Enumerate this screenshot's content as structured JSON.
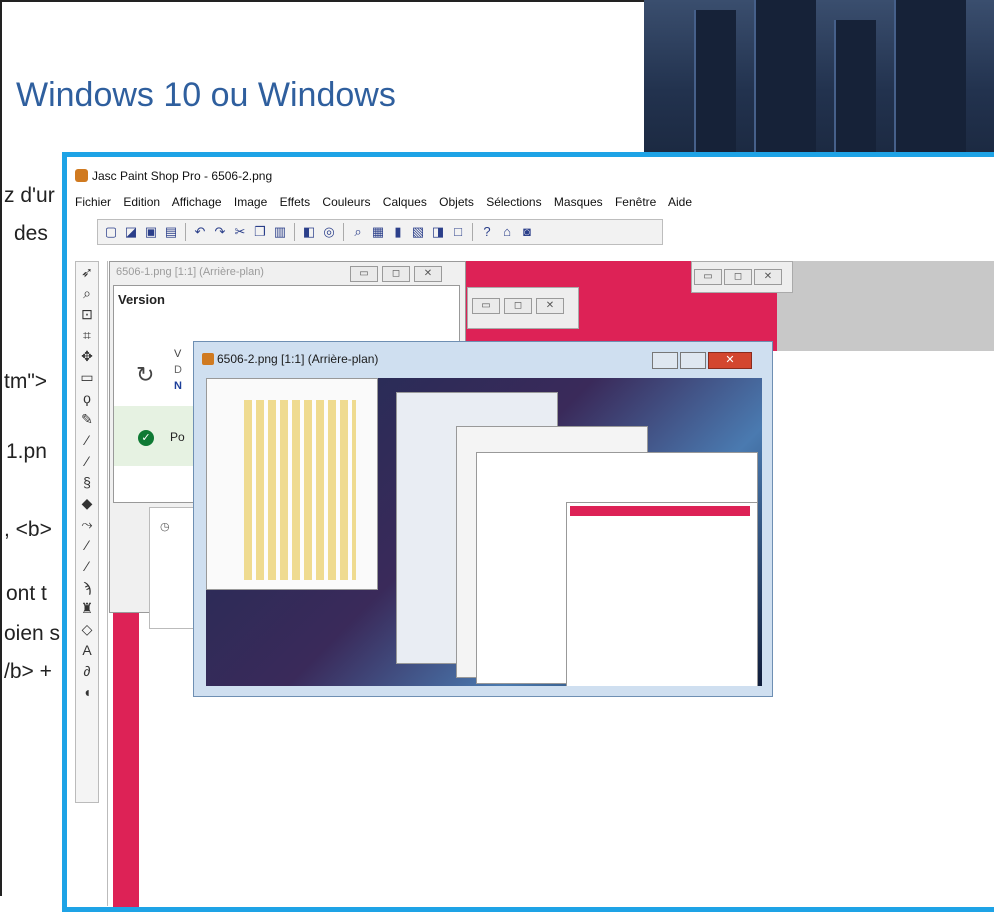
{
  "document": {
    "heading": "Windows 10 ou Windows",
    "fragments": [
      "z d'ur",
      "des",
      "tm\">",
      "1.pn",
      ", <b>",
      "ont t",
      "oien s",
      "/b> +"
    ]
  },
  "psp": {
    "title": "Jasc Paint Shop Pro - 6506-2.png",
    "menu": [
      "Fichier",
      "Edition",
      "Affichage",
      "Image",
      "Effets",
      "Couleurs",
      "Calques",
      "Objets",
      "Sélections",
      "Masques",
      "Fenêtre",
      "Aide"
    ],
    "toolbar_icons": [
      "new-icon",
      "open-icon",
      "save-icon",
      "print-icon",
      "undo-icon",
      "redo-icon",
      "cut-icon",
      "copy-icon",
      "paste-icon",
      "browse-icon",
      "capture-icon",
      "zoom-icon",
      "histogram-icon",
      "colors-icon",
      "layers-icon",
      "overview-icon",
      "window-icon",
      "help-icon",
      "lock-icon",
      "camera-icon"
    ],
    "tools": [
      "arrow-tool-icon",
      "zoom-tool-icon",
      "deform-tool-icon",
      "crop-tool-icon",
      "move-tool-icon",
      "selection-tool-icon",
      "freehand-selection-icon",
      "eyedropper-icon",
      "paintbrush-icon",
      "clone-brush-icon",
      "color-replacer-icon",
      "retouch-icon",
      "scratch-remover-icon",
      "eraser-icon",
      "picture-tube-icon",
      "airbrush-icon",
      "flood-fill-icon",
      "text-tool-icon",
      "draw-tool-icon",
      "preset-shapes-icon",
      "vector-tool-icon"
    ]
  },
  "win1": {
    "title": "6506-1.png [1:1] (Arrière-plan)",
    "version_title": "Version",
    "fragments": [
      "V",
      "D",
      "N",
      "Po"
    ]
  },
  "win_img": {
    "title": "6506-2.png [1:1] (Arrière-plan)"
  },
  "colors": {
    "psp_border": "#1ea3e6",
    "heading": "#2f5f9e",
    "pink": "#dd2256"
  }
}
